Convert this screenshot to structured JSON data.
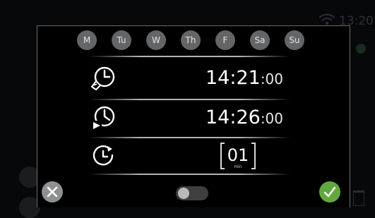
{
  "status_bar": {
    "time": "13:20",
    "wifi_icon": "wifi-icon"
  },
  "days": [
    {
      "label": "M"
    },
    {
      "label": "Tu"
    },
    {
      "label": "W"
    },
    {
      "label": "Th"
    },
    {
      "label": "F"
    },
    {
      "label": "Sa"
    },
    {
      "label": "Su"
    }
  ],
  "start": {
    "icon": "alarm-clock-icon",
    "hours_minutes": "14:21",
    "seconds": ":00"
  },
  "end": {
    "icon": "play-clock-icon",
    "hours_minutes": "14:26",
    "seconds": ":00"
  },
  "duration": {
    "icon": "timer-refresh-icon",
    "value": "01",
    "unit": "min"
  },
  "toggle": {
    "state": "off"
  },
  "colors": {
    "day_bg": "#636566",
    "confirm_green": "#62a83e",
    "cancel_grey": "#8e9092",
    "modal_border": "#6a6a6a"
  }
}
